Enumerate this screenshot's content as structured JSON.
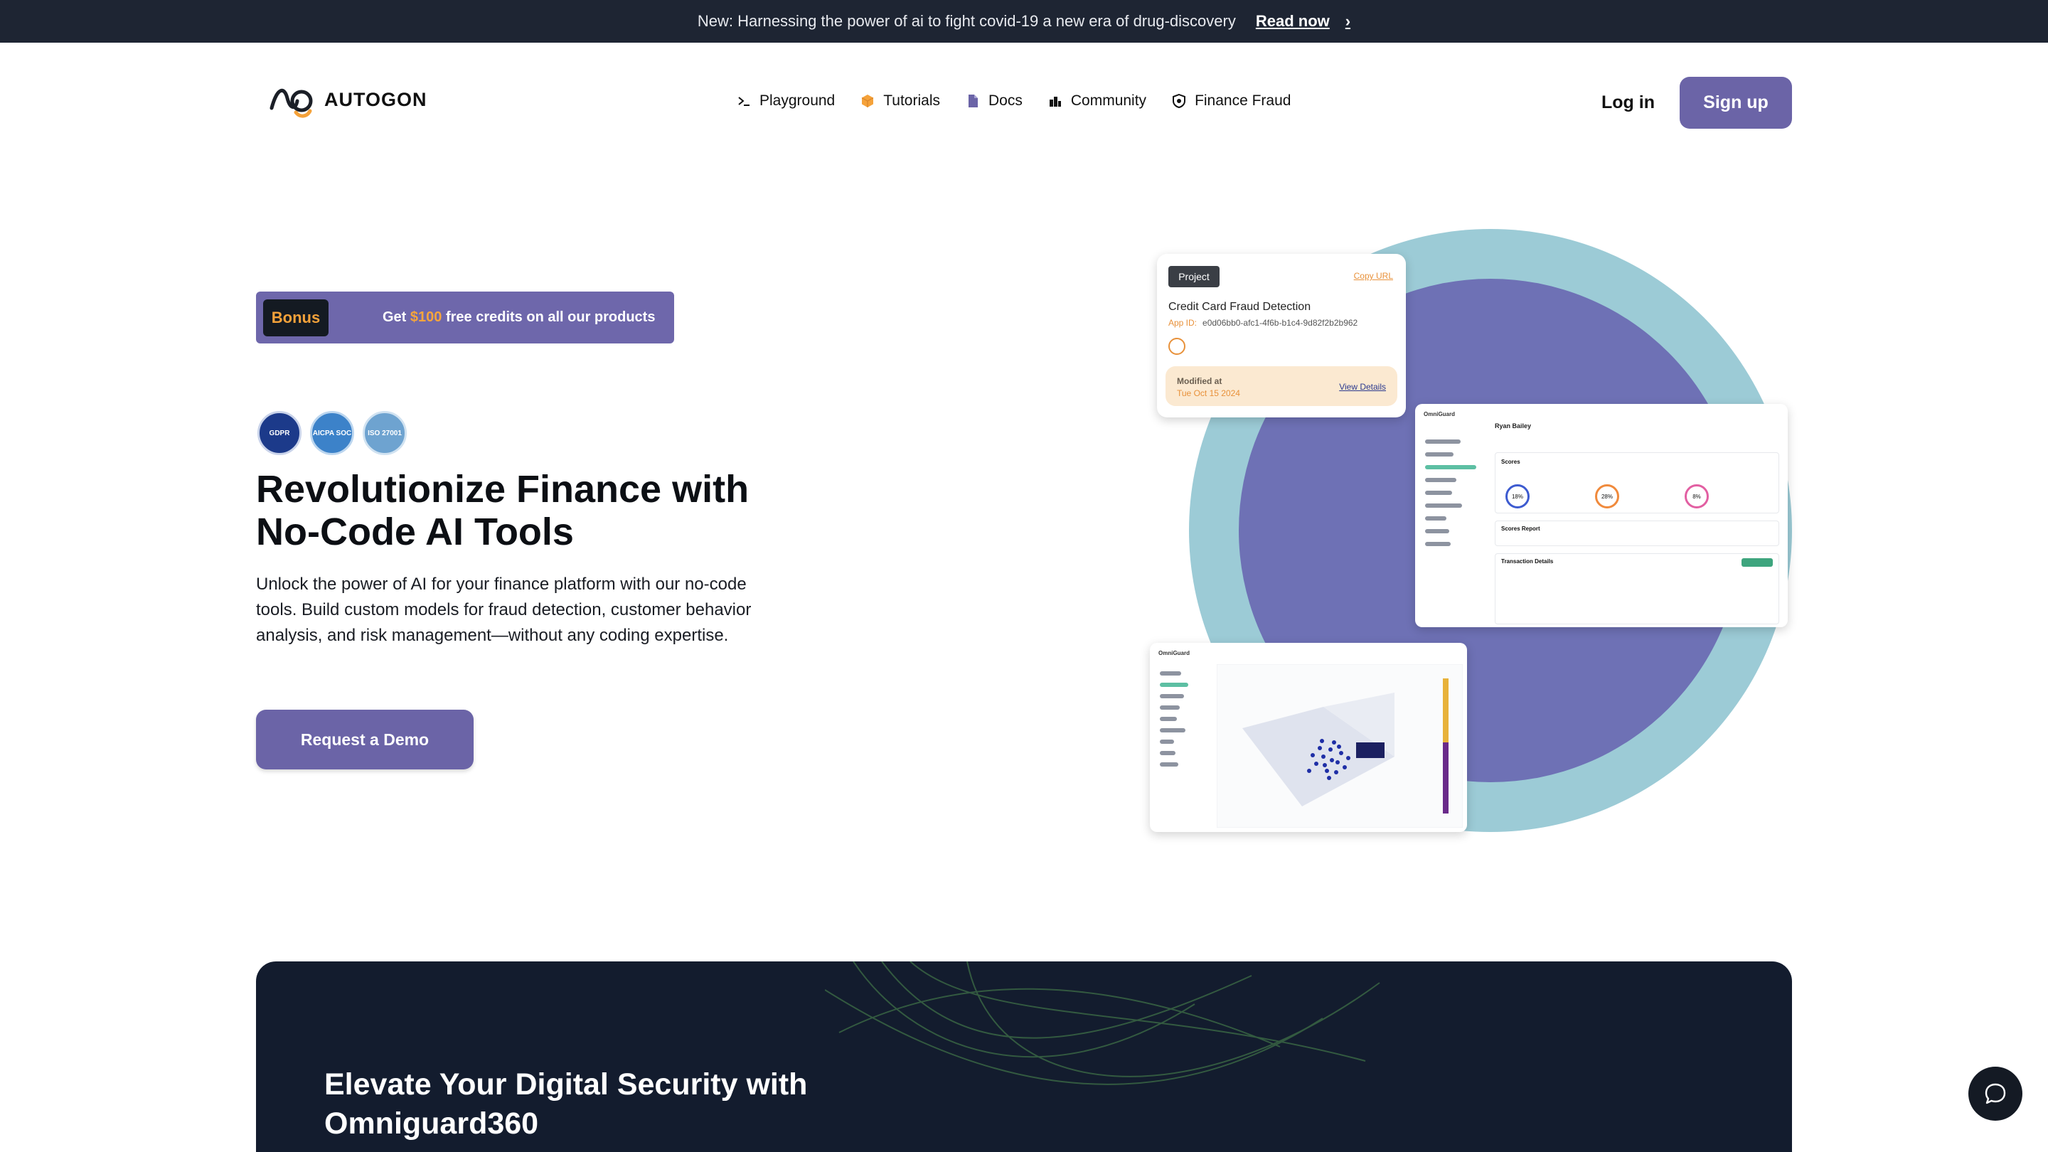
{
  "announcement": {
    "text": "New: Harnessing the power of ai to fight covid-19 a new era of drug-discovery",
    "link_label": "Read now"
  },
  "nav": {
    "logo_text": "AUTOGON",
    "menu": [
      {
        "label": "Playground",
        "icon": "terminal-icon"
      },
      {
        "label": "Tutorials",
        "icon": "cube-icon"
      },
      {
        "label": "Docs",
        "icon": "document-icon"
      },
      {
        "label": "Community",
        "icon": "community-icon"
      },
      {
        "label": "Finance Fraud",
        "icon": "shield-icon"
      }
    ],
    "login_label": "Log in",
    "signup_label": "Sign up"
  },
  "hero": {
    "bonus_tag": "Bonus",
    "bonus_prefix": "Get ",
    "bonus_amount": "$100",
    "bonus_suffix": " free credits on all our products",
    "badges": [
      {
        "label": "GDPR"
      },
      {
        "label": "AICPA SOC"
      },
      {
        "label": "ISO 27001"
      }
    ],
    "title": "Revolutionize Finance with No-Code AI Tools",
    "description": "Unlock the power of AI for your finance platform with our no-code tools. Build custom models for fraud detection, customer behavior analysis, and risk management—without any coding expertise.",
    "cta_label": "Request a Demo"
  },
  "project_card": {
    "tag": "Project",
    "copy_label": "Copy URL",
    "name": "Credit Card Fraud Detection",
    "app_id_label": "App ID:",
    "app_id": "e0d06bb0-afc1-4f6b-b1c4-9d82f2b2b962",
    "modified_label": "Modified at",
    "modified_date": "Tue Oct 15 2024",
    "view_details": "View Details"
  },
  "dashboard_card": {
    "brand": "OmniGuard",
    "user": "Ryan Bailey",
    "scores_heading": "Scores",
    "scores": [
      "18%",
      "28%",
      "8%"
    ],
    "report_heading": "Scores Report",
    "details_heading": "Transaction Details"
  },
  "plot_card": {
    "brand": "OmniGuard"
  },
  "band": {
    "title": "Elevate Your Digital Security with Omniguard360"
  },
  "colors": {
    "accent": "#6b64a7",
    "orange": "#f5a23a",
    "ring_outer": "#9ccbd6",
    "ring_inner": "#6e71b5",
    "dark": "#131c2e"
  }
}
